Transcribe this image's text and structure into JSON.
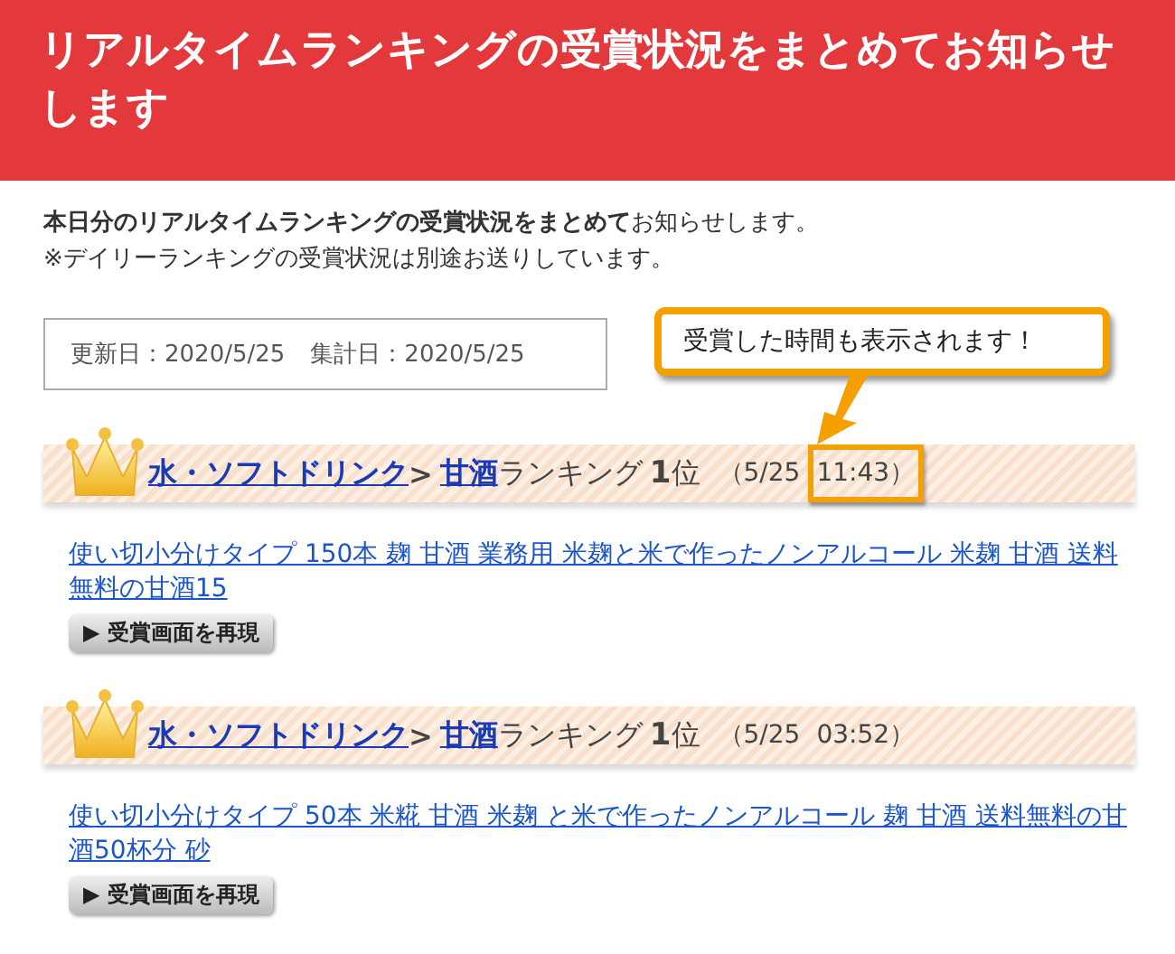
{
  "header": {
    "title": "リアルタイムランキングの受賞状況をまとめてお知らせします"
  },
  "intro": {
    "lines": [
      "**本日分のリアルタイムランキングの受賞状況をまとめて**お知らせします。",
      "※デイリーランキングの受賞状況は別途お送りしています。"
    ]
  },
  "dates": {
    "updated": "更新日：2020/5/25",
    "counted": "集計日：2020/5/25"
  },
  "callout": {
    "text": "受賞した時間も表示されます！"
  },
  "awards": [
    {
      "category": "水・ソフトドリンク",
      "separator": ">",
      "genre": "甘酒",
      "ranking_label": "ランキング",
      "rank": "1",
      "rank_unit": "位",
      "date": "（5/25",
      "time": "11:43）",
      "highlighted": true,
      "product": "使い切小分けタイプ 150本 麹 甘酒 業務用 米麹と米で作ったノンアルコール 米麹 甘酒 送料無料の甘酒15",
      "button": "▶ 受賞画面を再現"
    },
    {
      "category": "水・ソフトドリンク",
      "separator": ">",
      "genre": "甘酒",
      "ranking_label": "ランキング",
      "rank": "1",
      "rank_unit": "位",
      "date": "（5/25",
      "time": "03:52）",
      "highlighted": false,
      "product": "使い切小分けタイプ 50本 米糀 甘酒 米麹 と米で作ったノンアルコール 麹 甘酒 送料無料の甘酒50杯分 砂",
      "button": "▶ 受賞画面を再現"
    }
  ]
}
